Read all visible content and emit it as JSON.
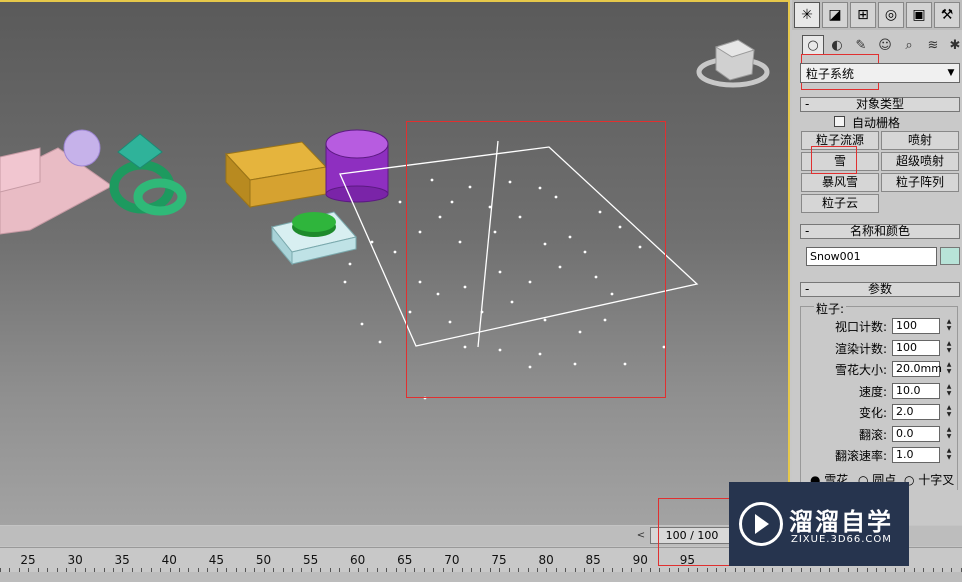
{
  "panel": {
    "category_dropdown": "粒子系统",
    "object_type": {
      "title": "对象类型",
      "auto_grid": "自动栅格",
      "buttons": [
        "粒子流源",
        "喷射",
        "雪",
        "超级喷射",
        "暴风雪",
        "粒子阵列",
        "粒子云"
      ]
    },
    "name_color": {
      "title": "名称和颜色",
      "name": "Snow001",
      "color": "#b8e3d8"
    },
    "params": {
      "title": "参数",
      "group_label": "粒子:",
      "rows": [
        {
          "label": "视口计数:",
          "value": "100"
        },
        {
          "label": "渲染计数:",
          "value": "100"
        },
        {
          "label": "雪花大小:",
          "value": "20.0mm"
        },
        {
          "label": "速度:",
          "value": "10.0"
        },
        {
          "label": "变化:",
          "value": "2.0"
        },
        {
          "label": "翻滚:",
          "value": "0.0"
        },
        {
          "label": "翻滚速率:",
          "value": "1.0"
        }
      ],
      "radio": [
        "雪花",
        "圆点",
        "十字叉"
      ]
    }
  },
  "timeline": {
    "frame_display": "100 / 100",
    "ruler_labels": [
      "25",
      "30",
      "35",
      "40",
      "45",
      "50",
      "55",
      "60",
      "65",
      "70",
      "75",
      "80",
      "85",
      "90",
      "95"
    ]
  },
  "watermark": {
    "name": "溜溜自学",
    "url": "ZIXUE.3D66.COM"
  }
}
